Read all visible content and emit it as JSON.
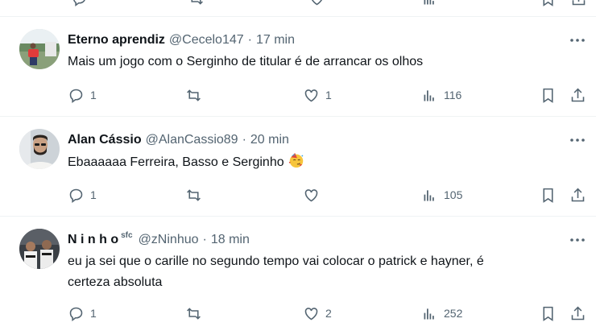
{
  "tweets": [
    {
      "name": "Eterno aprendiz",
      "handle": "@Cecelo147",
      "separator": "·",
      "time": "17 min",
      "text": "Mais um jogo com o Serginho de titular é de arrancar os olhos",
      "replies": "1",
      "retweets": "",
      "likes": "1",
      "views": "116"
    },
    {
      "name": "Alan Cássio",
      "handle": "@AlanCassio89",
      "separator": "·",
      "time": "20 min",
      "text": "Ebaaaaaa Ferreira, Basso e Serginho",
      "emoji": "party-face-emoji",
      "replies": "1",
      "retweets": "",
      "likes": "",
      "views": "105"
    },
    {
      "name": "N i n h o",
      "name_superscript": "sfc",
      "handle": "@zNinhuo",
      "separator": "·",
      "time": "18 min",
      "text_line1": "eu ja sei que o carille no segundo tempo vai colocar o patrick e hayner, é",
      "text_line2": "certeza absoluta",
      "replies": "1",
      "retweets": "",
      "likes": "2",
      "views": "252"
    }
  ],
  "colors": {
    "text_primary": "#0f1419",
    "text_secondary": "#536471",
    "divider": "#eff3f4"
  },
  "icons": [
    "reply-icon",
    "retweet-icon",
    "like-icon",
    "views-icon",
    "bookmark-icon",
    "share-icon",
    "more-icon"
  ]
}
